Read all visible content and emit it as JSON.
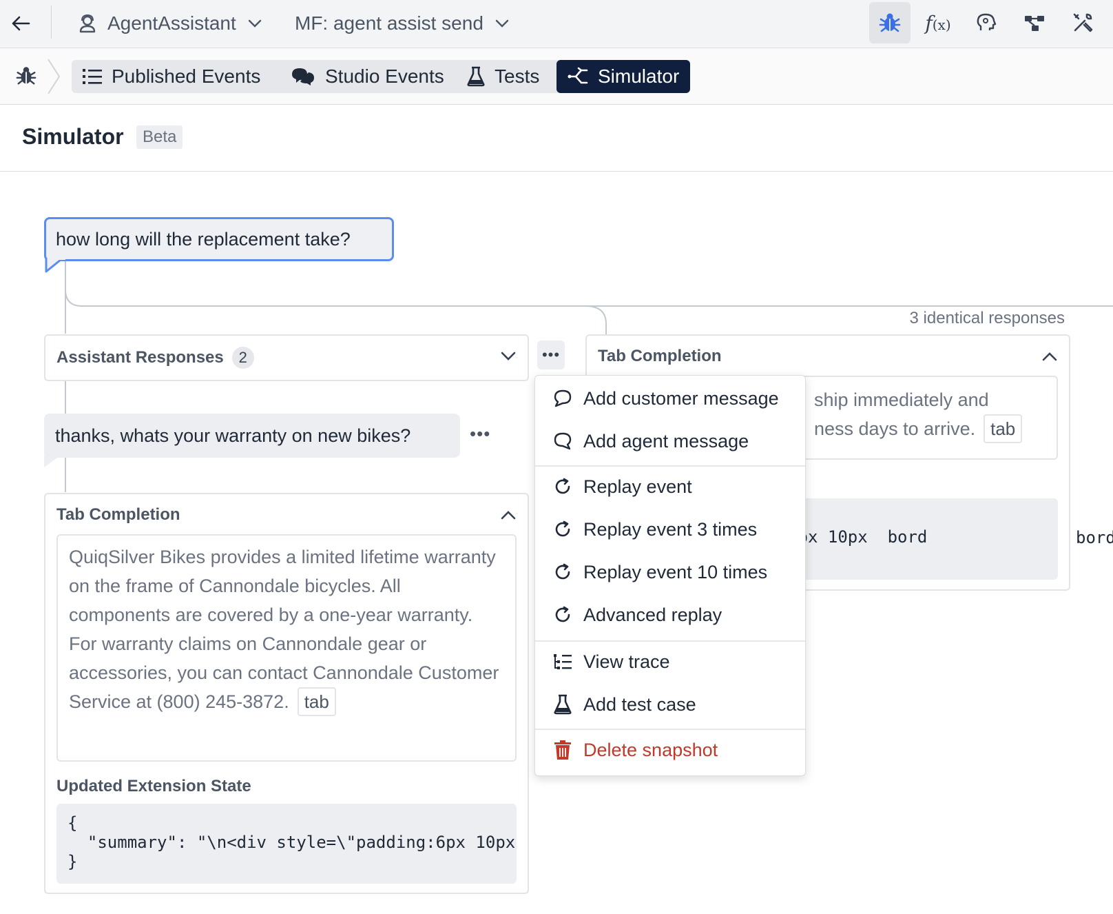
{
  "topbar": {
    "app_name": "AgentAssistant",
    "flow_name": "MF: agent assist send",
    "icons": [
      "back-arrow-icon",
      "agent-icon",
      "chevron-down-icon",
      "bug-icon",
      "function-icon",
      "brain-icon",
      "network-icon",
      "tools-icon"
    ]
  },
  "subnav": {
    "tabs": [
      {
        "label": "Published Events",
        "icon": "list-icon"
      },
      {
        "label": "Studio Events",
        "icon": "chat-icon"
      },
      {
        "label": "Tests",
        "icon": "flask-icon"
      },
      {
        "label": "Simulator",
        "icon": "share-icon",
        "active": true
      }
    ]
  },
  "header": {
    "title": "Simulator",
    "badge": "Beta"
  },
  "conversation": {
    "customer_message": "how long will the replacement take?",
    "identical_label": "3 identical responses",
    "assistant_responses": {
      "title": "Assistant Responses",
      "count": "2"
    },
    "agent_message": "thanks, whats your warranty on new bikes?",
    "left_completion": {
      "title": "Tab Completion",
      "text": "QuiqSilver Bikes provides a limited lifetime warranty on the frame of Cannondale bicycles. All components are covered by a one-year warranty. For warranty claims on Cannondale gear or accessories, you can contact Cannondale Customer Service at (800) 245-3872.",
      "chip": "tab",
      "state_title": "Updated Extension State",
      "state_code": "{\n  \"summary\": \"\\n<div style=\\\"padding:6px 10px\n}"
    },
    "right_completion": {
      "title": "Tab Completion",
      "line1": "ship immediately and",
      "line2": "ness days to arrive.",
      "chip": "tab",
      "code": "  style=\\\"padding:6px 10px  bord"
    }
  },
  "menu": {
    "items": [
      {
        "label": "Add customer message",
        "icon": "chat-bubble-icon"
      },
      {
        "label": "Add agent message",
        "icon": "chat-bubble-outline-icon"
      },
      {
        "label": "Replay event",
        "icon": "redo-icon"
      },
      {
        "label": "Replay event 3 times",
        "icon": "redo-icon"
      },
      {
        "label": "Replay event 10 times",
        "icon": "redo-icon"
      },
      {
        "label": "Advanced replay",
        "icon": "redo-icon"
      },
      {
        "label": "View trace",
        "icon": "trace-icon"
      },
      {
        "label": "Add test case",
        "icon": "flask-icon"
      },
      {
        "label": "Delete snapshot",
        "icon": "trash-icon"
      }
    ]
  },
  "colors": {
    "accent_blue": "#3b6fe6",
    "active_tab_bg": "#0f1f3d",
    "danger": "#c0392b",
    "bubble_border": "#5b8def"
  }
}
